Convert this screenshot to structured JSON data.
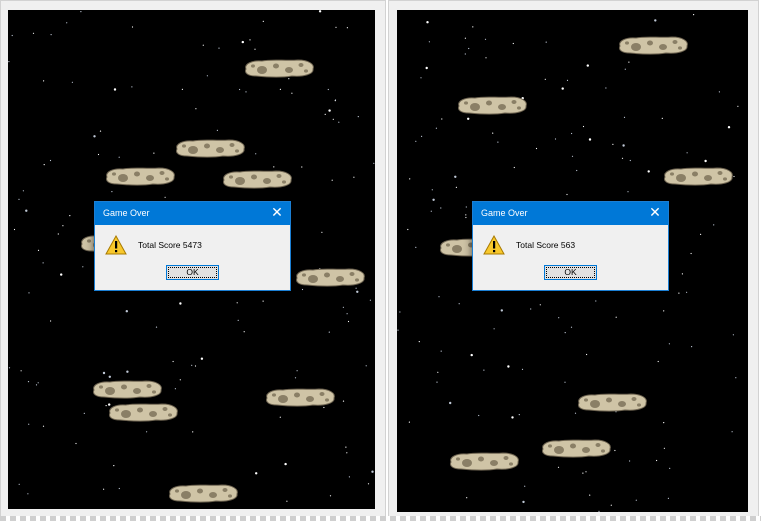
{
  "windows": [
    {
      "dialog": {
        "title": "Game Over",
        "message": "Total Score 5473",
        "ok_label": "OK",
        "close_glyph": "✕",
        "icon": "warning-icon"
      }
    },
    {
      "dialog": {
        "title": "Game Over",
        "message": "Total Score 563",
        "ok_label": "OK",
        "close_glyph": "✕",
        "icon": "warning-icon"
      }
    }
  ],
  "colors": {
    "titlebar": "#0078d7",
    "space": "#000000",
    "asteroid": "#cfc4a6"
  }
}
